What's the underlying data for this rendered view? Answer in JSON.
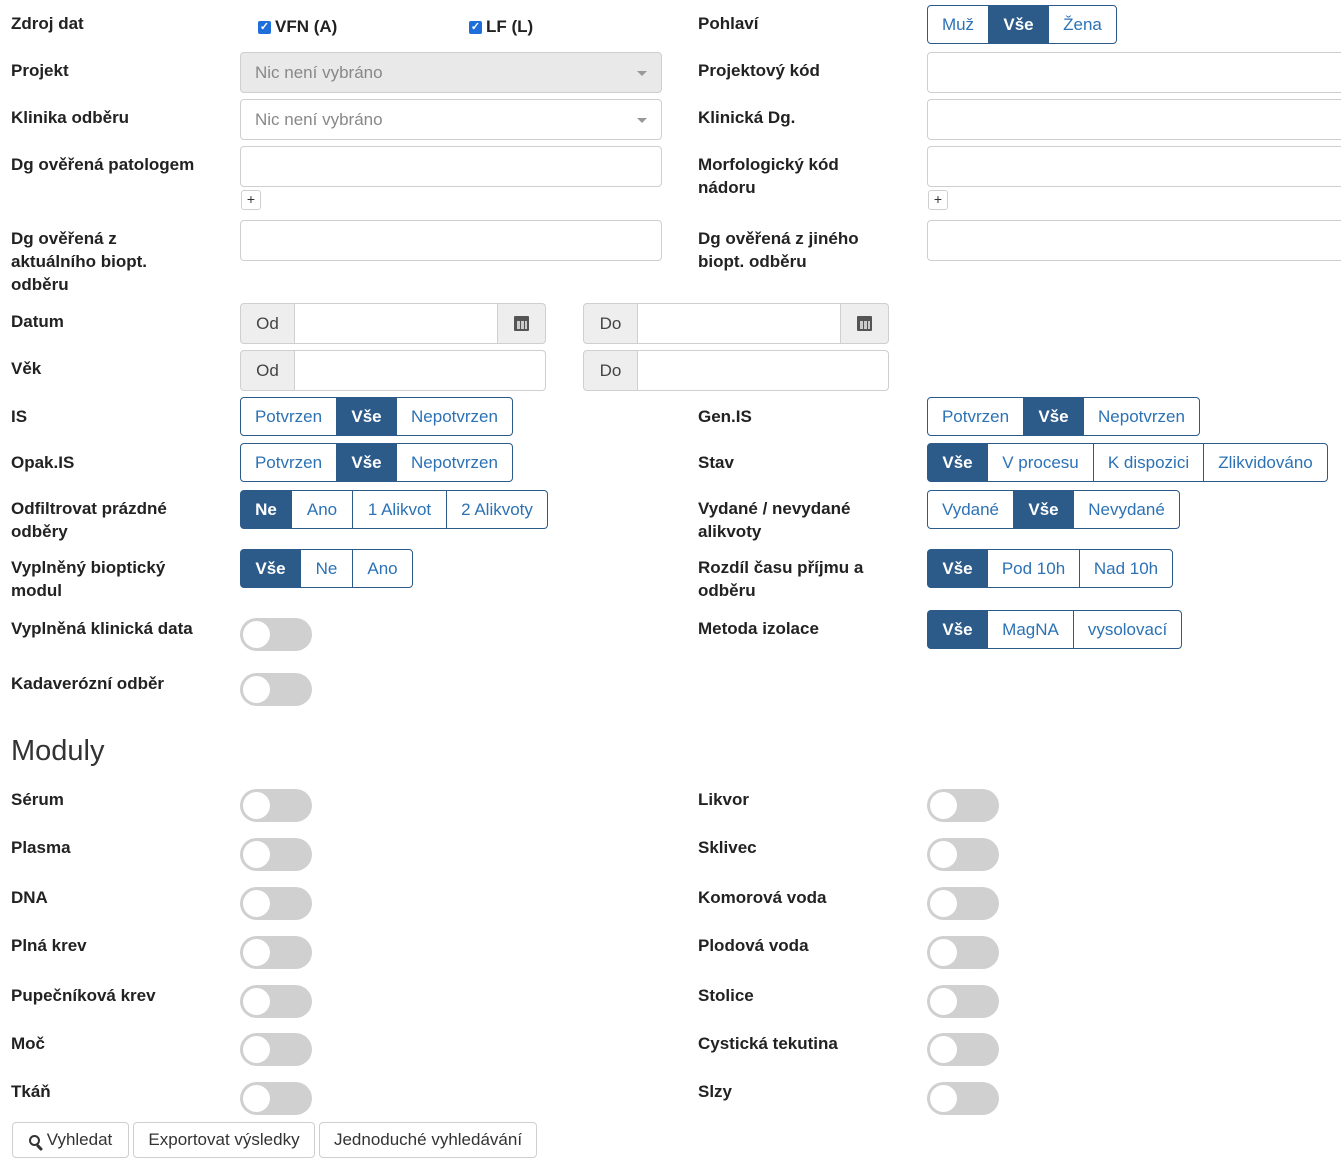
{
  "source": {
    "label": "Zdroj dat",
    "opt1": "VFN (A)",
    "opt2": "LF (L)"
  },
  "sex": {
    "label": "Pohlaví",
    "options": [
      "Muž",
      "Vše",
      "Žena"
    ]
  },
  "project": {
    "label": "Projekt",
    "placeholder": "Nic není vybráno"
  },
  "project_code": {
    "label": "Projektový kód"
  },
  "clinic": {
    "label": "Klinika odběru",
    "placeholder": "Nic není vybráno"
  },
  "clinical_dg": {
    "label": "Klinická Dg."
  },
  "dg_pathologist": {
    "label": "Dg ověřená patologem",
    "add": "+"
  },
  "morph_code": {
    "label": "Morfologický kód nádoru",
    "add": "+"
  },
  "dg_current_biopsy": {
    "label": "Dg ověřená z aktuálního biopt. odběru"
  },
  "dg_other_biopsy": {
    "label": "Dg ověřená z jiného biopt. odběru"
  },
  "date": {
    "label": "Datum",
    "from": "Od",
    "to": "Do"
  },
  "age": {
    "label": "Věk",
    "from": "Od",
    "to": "Do"
  },
  "is": {
    "label": "IS",
    "options": [
      "Potvrzen",
      "Vše",
      "Nepotvrzen"
    ]
  },
  "gen_is": {
    "label": "Gen.IS",
    "options": [
      "Potvrzen",
      "Vše",
      "Nepotvrzen"
    ]
  },
  "opak_is": {
    "label": "Opak.IS",
    "options": [
      "Potvrzen",
      "Vše",
      "Nepotvrzen"
    ]
  },
  "status": {
    "label": "Stav",
    "options": [
      "Vše",
      "V procesu",
      "K dispozici",
      "Zlikvidováno"
    ]
  },
  "filter_empty": {
    "label": "Odfiltrovat prázdné odběry",
    "options": [
      "Ne",
      "Ano",
      "1 Alikvot",
      "2 Alikvoty"
    ]
  },
  "issued": {
    "label": "Vydané / nevydané alikvoty",
    "options": [
      "Vydané",
      "Vše",
      "Nevydané"
    ]
  },
  "biopsy_module": {
    "label": "Vyplněný bioptický modul",
    "options": [
      "Vše",
      "Ne",
      "Ano"
    ]
  },
  "time_diff": {
    "label": "Rozdíl času příjmu a odběru",
    "options": [
      "Vše",
      "Pod 10h",
      "Nad 10h"
    ]
  },
  "clinical_data": {
    "label": "Vyplněná klinická data"
  },
  "isolation": {
    "label": "Metoda izolace",
    "options": [
      "Vše",
      "MagNA",
      "vysolovací"
    ]
  },
  "cadaver": {
    "label": "Kadaverózní odběr"
  },
  "modules": {
    "title": "Moduly",
    "left": [
      "Sérum",
      "Plasma",
      "DNA",
      "Plná krev",
      "Pupečníková krev",
      "Moč",
      "Tkáň"
    ],
    "right": [
      "Likvor",
      "Sklivec",
      "Komorová voda",
      "Plodová voda",
      "Stolice",
      "Cystická tekutina",
      "Slzy"
    ]
  },
  "actions": {
    "search": "Vyhledat",
    "export": "Exportovat výsledky",
    "simple": "Jednoduché vyhledávání"
  },
  "colors": {
    "primary": "#2c5b8a",
    "link": "#2c72b5",
    "checkbox": "#1e6fd9"
  },
  "icons": {
    "search": "search-icon",
    "calendar": "calendar-icon"
  }
}
